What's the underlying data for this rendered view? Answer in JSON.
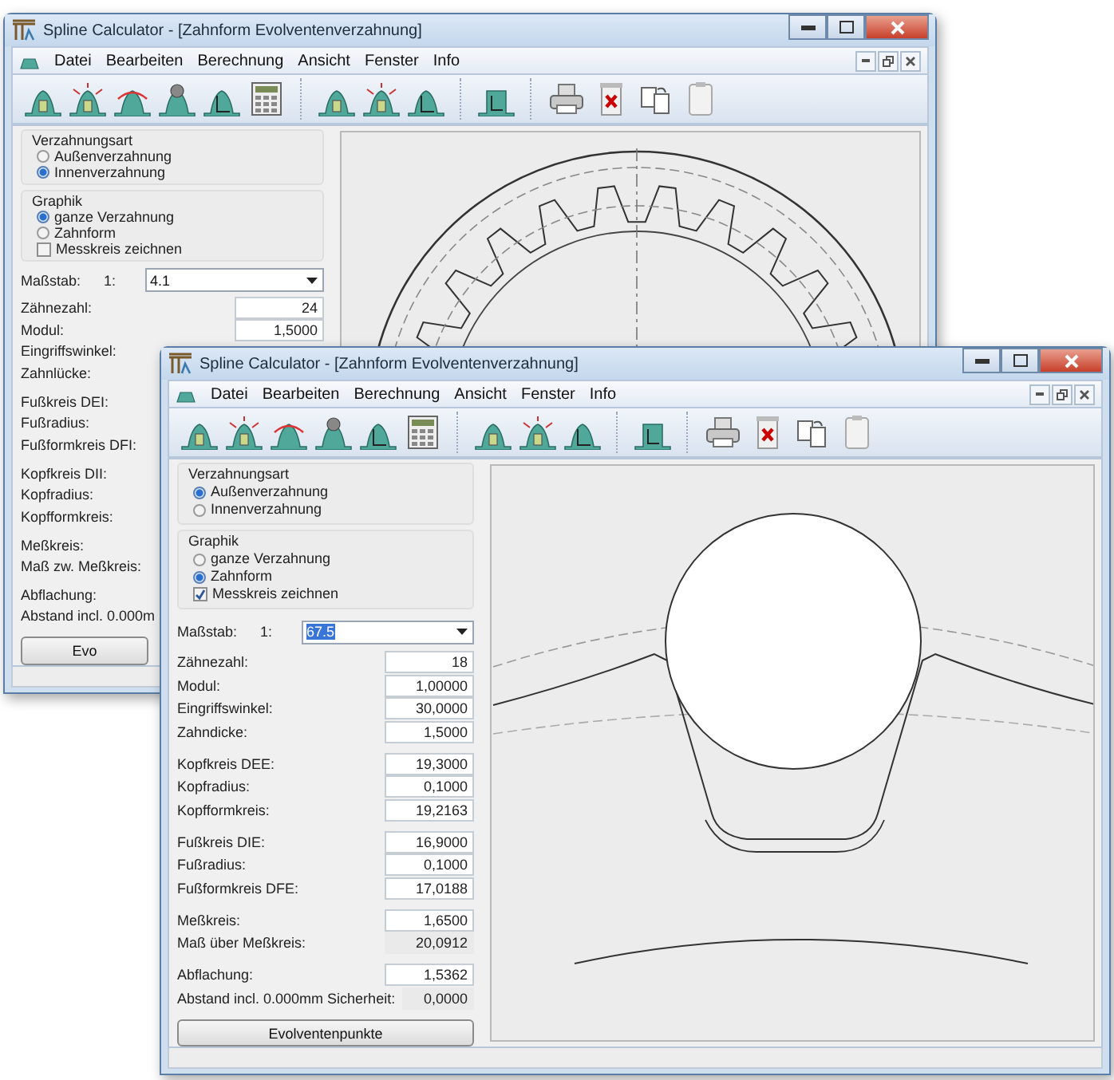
{
  "windows": [
    {
      "kind": "ring_gear",
      "title": "Spline Calculator - [Zahnform Evolventenverzahnung]",
      "menu": [
        "Datei",
        "Bearbeiten",
        "Berechnung",
        "Ansicht",
        "Fenster",
        "Info"
      ],
      "verzahnungsart": {
        "label": "Verzahnungsart",
        "options": [
          {
            "label": "Außenverzahnung",
            "selected": false
          },
          {
            "label": "Innenverzahnung",
            "selected": true
          }
        ]
      },
      "graphik": {
        "label": "Graphik",
        "options": [
          {
            "label": "ganze Verzahnung",
            "selected": true
          },
          {
            "label": "Zahnform",
            "selected": false
          }
        ],
        "checkbox": {
          "label": "Messkreis zeichnen",
          "checked": false
        }
      },
      "scale": {
        "label": "Maßstab:",
        "prefix": "1:",
        "value": "4.1",
        "text_selected": false
      },
      "field_groups": [
        [
          {
            "kind": "input",
            "label": "Zähnezahl:",
            "value": "24"
          },
          {
            "kind": "input",
            "label": "Modul:",
            "value": "1,5000"
          },
          {
            "kind": "label",
            "label": "Eingriffswinkel:"
          },
          {
            "kind": "label",
            "label": "Zahnlücke:"
          }
        ],
        [
          {
            "kind": "label",
            "label": "Fußkreis DEI:"
          },
          {
            "kind": "label",
            "label": "Fußradius:"
          },
          {
            "kind": "label",
            "label": "Fußformkreis DFI:"
          }
        ],
        [
          {
            "kind": "label",
            "label": "Kopfkreis DII:"
          },
          {
            "kind": "label",
            "label": "Kopfradius:"
          },
          {
            "kind": "label",
            "label": "Kopfformkreis:"
          }
        ],
        [
          {
            "kind": "label",
            "label": "Meßkreis:"
          },
          {
            "kind": "label",
            "label": "Maß zw. Meßkreis:"
          }
        ],
        [
          {
            "kind": "label",
            "label": "Abflachung:"
          },
          {
            "kind": "label",
            "label": "Abstand incl. 0.000m"
          }
        ]
      ],
      "button": "Evo"
    },
    {
      "kind": "tooth_form",
      "title": "Spline Calculator - [Zahnform Evolventenverzahnung]",
      "menu": [
        "Datei",
        "Bearbeiten",
        "Berechnung",
        "Ansicht",
        "Fenster",
        "Info"
      ],
      "verzahnungsart": {
        "label": "Verzahnungsart",
        "options": [
          {
            "label": "Außenverzahnung",
            "selected": true
          },
          {
            "label": "Innenverzahnung",
            "selected": false
          }
        ]
      },
      "graphik": {
        "label": "Graphik",
        "options": [
          {
            "label": "ganze Verzahnung",
            "selected": false
          },
          {
            "label": "Zahnform",
            "selected": true
          }
        ],
        "checkbox": {
          "label": "Messkreis zeichnen",
          "checked": true
        }
      },
      "scale": {
        "label": "Maßstab:",
        "prefix": "1:",
        "value": "67.5",
        "text_selected": true
      },
      "field_groups": [
        [
          {
            "kind": "input",
            "label": "Zähnezahl:",
            "value": "18"
          },
          {
            "kind": "input",
            "label": "Modul:",
            "value": "1,00000"
          },
          {
            "kind": "input",
            "label": "Eingriffswinkel:",
            "value": "30,0000"
          },
          {
            "kind": "input",
            "label": "Zahndicke:",
            "value": "1,5000"
          }
        ],
        [
          {
            "kind": "input",
            "label": "Kopfkreis DEE:",
            "value": "19,3000"
          },
          {
            "kind": "input",
            "label": "Kopfradius:",
            "value": "0,1000"
          },
          {
            "kind": "input",
            "label": "Kopfformkreis:",
            "value": "19,2163"
          }
        ],
        [
          {
            "kind": "input",
            "label": "Fußkreis DIE:",
            "value": "16,9000"
          },
          {
            "kind": "input",
            "label": "Fußradius:",
            "value": "0,1000"
          },
          {
            "kind": "input",
            "label": "Fußformkreis DFE:",
            "value": "17,0188"
          }
        ],
        [
          {
            "kind": "input",
            "label": "Meßkreis:",
            "value": "1,6500"
          },
          {
            "kind": "readonly",
            "label": "Maß über Meßkreis:",
            "value": "20,0912"
          }
        ],
        [
          {
            "kind": "input",
            "label": "Abflachung:",
            "value": "1,5362"
          },
          {
            "kind": "readonly",
            "label": "Abstand incl. 0.000mm Sicherheit:",
            "value": "0,0000"
          }
        ]
      ],
      "button": "Evolventenpunkte"
    }
  ]
}
